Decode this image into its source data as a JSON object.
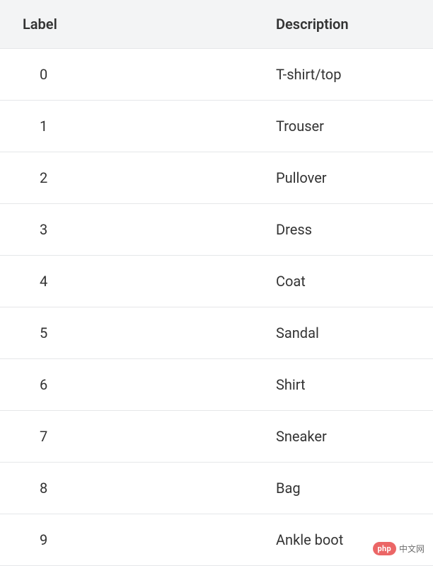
{
  "table": {
    "headers": {
      "label": "Label",
      "description": "Description"
    },
    "rows": [
      {
        "label": "0",
        "description": "T-shirt/top"
      },
      {
        "label": "1",
        "description": "Trouser"
      },
      {
        "label": "2",
        "description": "Pullover"
      },
      {
        "label": "3",
        "description": "Dress"
      },
      {
        "label": "4",
        "description": "Coat"
      },
      {
        "label": "5",
        "description": "Sandal"
      },
      {
        "label": "6",
        "description": "Shirt"
      },
      {
        "label": "7",
        "description": "Sneaker"
      },
      {
        "label": "8",
        "description": "Bag"
      },
      {
        "label": "9",
        "description": "Ankle boot"
      }
    ]
  },
  "watermark": {
    "badge": "php",
    "text": "中文网"
  }
}
